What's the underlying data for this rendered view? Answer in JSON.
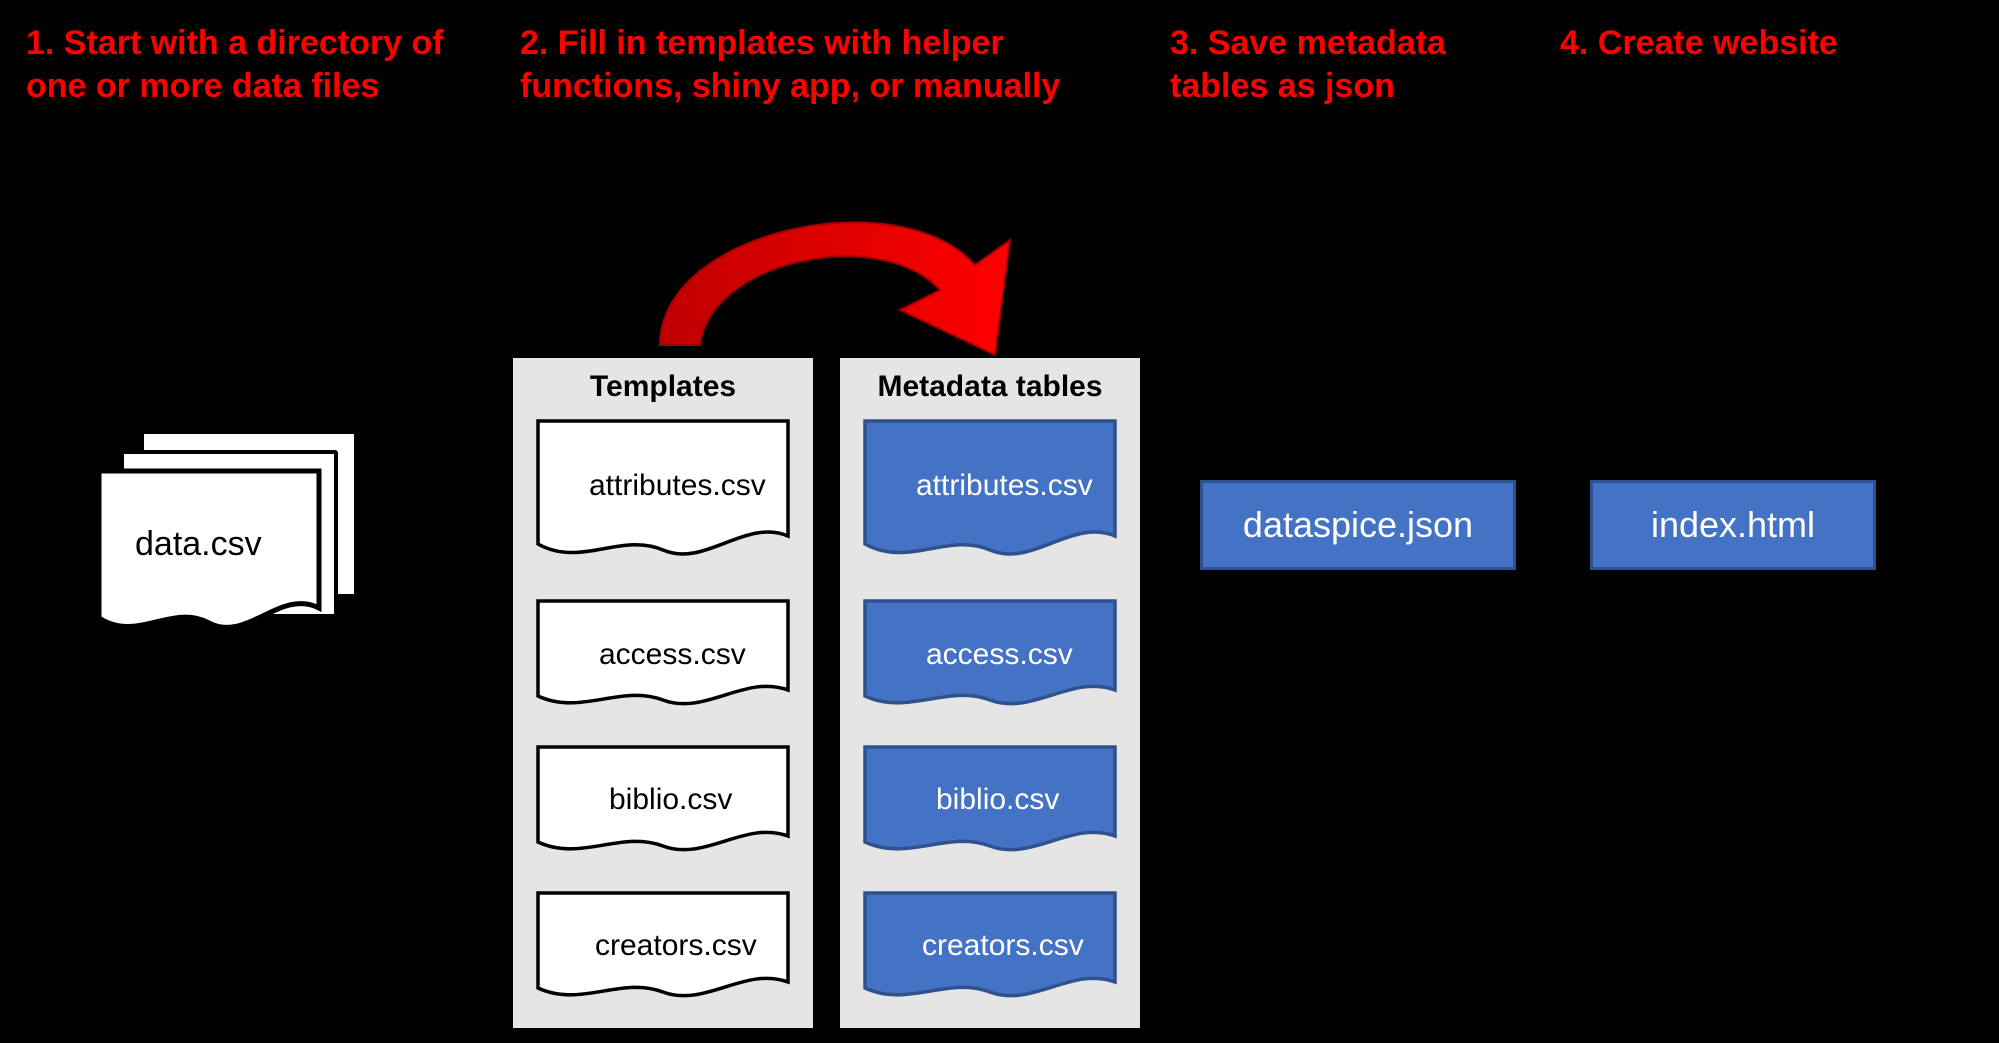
{
  "steps": {
    "s1": "1. Start with a directory of one or more data files",
    "s2": "2. Fill in templates with helper functions, shiny app, or manually",
    "s3": "3. Save metadata tables as json",
    "s4": "4. Create website"
  },
  "dataFile": {
    "label": "data.csv"
  },
  "panels": {
    "templates": {
      "title": "Templates",
      "items": {
        "attributes": "attributes.csv",
        "access": "access.csv",
        "biblio": "biblio.csv",
        "creators": "creators.csv"
      }
    },
    "metadata": {
      "title": "Metadata tables",
      "items": {
        "attributes": "attributes.csv",
        "access": "access.csv",
        "biblio": "biblio.csv",
        "creators": "creators.csv"
      }
    }
  },
  "outputs": {
    "json": "dataspice.json",
    "html": "index.html"
  }
}
